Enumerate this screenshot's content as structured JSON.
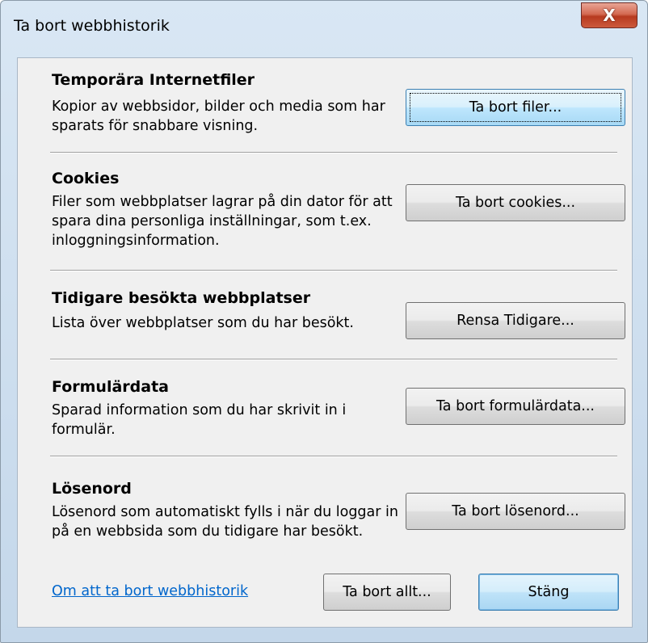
{
  "window": {
    "title": "Ta bort webbhistorik",
    "close_label": "X"
  },
  "sections": [
    {
      "title": "Temporära Internetfiler",
      "description": "Kopior av webbsidor, bilder och media som har sparats för snabbare visning.",
      "button_label": "Ta bort filer..."
    },
    {
      "title": "Cookies",
      "description": "Filer som webbplatser lagrar på din dator för att spara dina personliga inställningar, som t.ex. inloggningsinformation.",
      "button_label": "Ta bort cookies..."
    },
    {
      "title": "Tidigare besökta webbplatser",
      "description": "Lista över webbplatser som du har besökt.",
      "button_label": "Rensa Tidigare..."
    },
    {
      "title": "Formulärdata",
      "description": "Sparad information som du har skrivit in i formulär.",
      "button_label": "Ta bort formulärdata..."
    },
    {
      "title": "Lösenord",
      "description": "Lösenord som automatiskt fylls i när du loggar in på en webbsida som du tidigare har besökt.",
      "button_label": "Ta bort lösenord..."
    }
  ],
  "footer": {
    "help_link": "Om att ta bort webbhistorik",
    "delete_all_label": "Ta bort allt...",
    "close_label": "Stäng"
  }
}
